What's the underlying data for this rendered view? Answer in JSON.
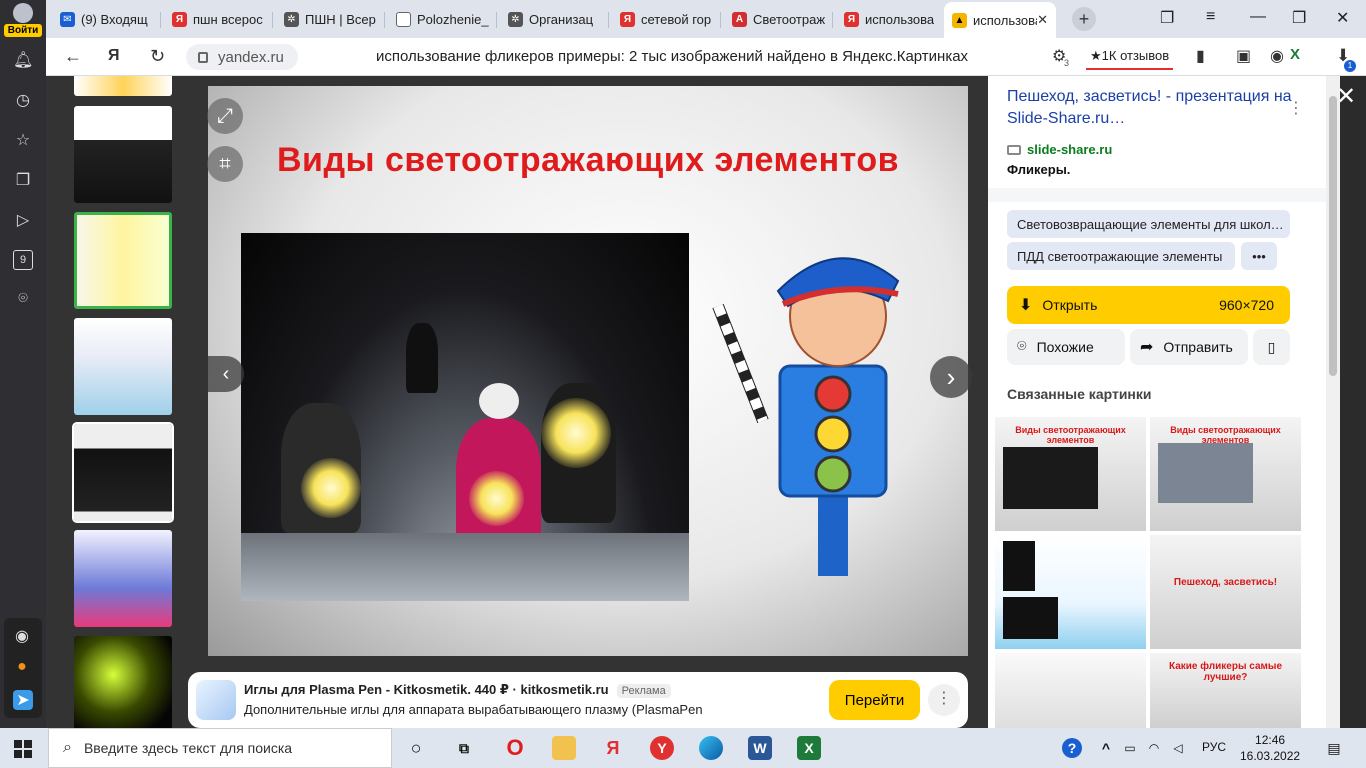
{
  "user": {
    "login_label": "Войти"
  },
  "tabs": [
    {
      "title": "(9) Входящ",
      "icon": "mail-icon",
      "color": "#1a5fd0"
    },
    {
      "title": "пшн всерос",
      "icon": "yandex-icon",
      "color": "#e03030"
    },
    {
      "title": "ПШН | Всер",
      "icon": "gear-icon",
      "color": "#555555"
    },
    {
      "title": "Polozhenie_",
      "icon": "document-icon",
      "color": "#666666"
    },
    {
      "title": "Организац",
      "icon": "gear-icon",
      "color": "#555555"
    },
    {
      "title": "сетевой гор",
      "icon": "yandex-icon",
      "color": "#e03030"
    },
    {
      "title": "Светоотраж",
      "icon": "pdf-icon",
      "color": "#d32f2f"
    },
    {
      "title": "использова",
      "icon": "yandex-icon",
      "color": "#e03030"
    },
    {
      "title": "использова",
      "icon": "images-icon",
      "color": "#f5b400",
      "active": true
    }
  ],
  "address": {
    "domain": "yandex.ru",
    "page_title": "использование фликеров примеры: 2 тыс изображений найдено в Яндекс.Картинках",
    "reviews": "★1К отзывов",
    "badge_count": "3",
    "ext_badge": "1"
  },
  "slide": {
    "title": "Виды светоотражающих элементов"
  },
  "ad": {
    "title": "Иглы для Plasma Pen - Kitkosmetik. 440 ₽ · kitkosmetik.ru",
    "tag": "Реклама",
    "desc": "Дополнительные иглы для аппарата вырабатывающего плазму (PlasmaPen",
    "cta": "Перейти"
  },
  "panel": {
    "title": "Пешеход, засветись! - презентация на Slide-Share.ru…",
    "site": "slide-share.ru",
    "subtitle": "Фликеры.",
    "chips": [
      "Световозвращающие элементы для школ…",
      "ПДД светоотражающие элементы",
      "•••"
    ],
    "open_label": "Открыть",
    "open_size": "960×720",
    "similar_label": "Похожие",
    "share_label": "Отправить",
    "related_heading": "Связанные картинки",
    "related": [
      "Виды светоотражающих элементов",
      "Виды светоотражающих элементов",
      "",
      "Пешеход, засветись!",
      "",
      "Какие фликеры самые лучшие?"
    ]
  },
  "taskbar": {
    "search_placeholder": "Введите здесь текст для поиска",
    "lang": "РУС",
    "time": "12:46",
    "date": "16.03.2022"
  }
}
